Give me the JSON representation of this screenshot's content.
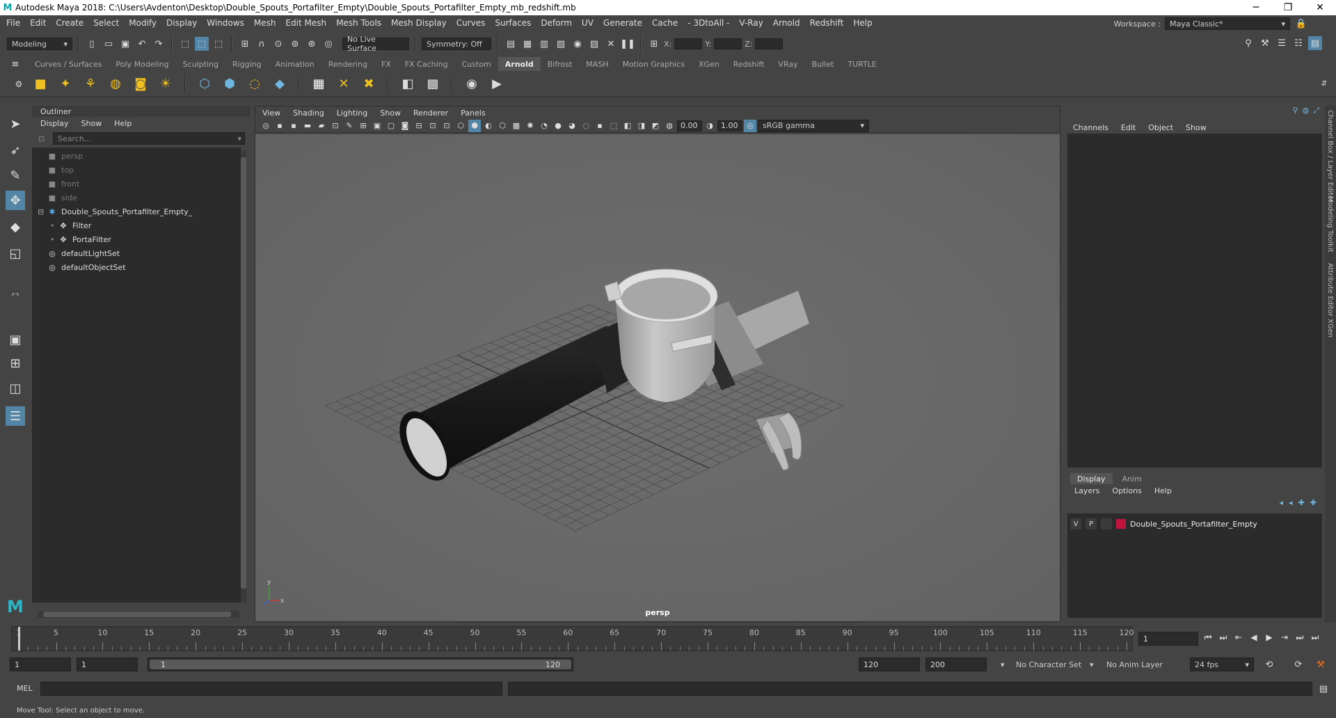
{
  "window": {
    "title": "Autodesk Maya 2018: C:\\Users\\Avdenton\\Desktop\\Double_Spouts_Portafilter_Empty\\Double_Spouts_Portafilter_Empty_mb_redshift.mb",
    "logo": "M"
  },
  "menubar": {
    "items": [
      "File",
      "Edit",
      "Create",
      "Select",
      "Modify",
      "Display",
      "Windows",
      "Mesh",
      "Edit Mesh",
      "Mesh Tools",
      "Mesh Display",
      "Curves",
      "Surfaces",
      "Deform",
      "UV",
      "Generate",
      "Cache",
      "- 3DtoAll -",
      "V-Ray",
      "Arnold",
      "Redshift",
      "Help"
    ],
    "workspace_label": "Workspace :",
    "workspace_value": "Maya Classic*"
  },
  "statusline": {
    "mode": "Modeling",
    "live_surface": "No Live Surface",
    "symmetry": "Symmetry: Off",
    "x_label": "X:",
    "y_label": "Y:",
    "z_label": "Z:"
  },
  "shelf": {
    "tabs": [
      "Curves / Surfaces",
      "Poly Modeling",
      "Sculpting",
      "Rigging",
      "Animation",
      "Rendering",
      "FX",
      "FX Caching",
      "Custom",
      "Arnold",
      "Bifrost",
      "MASH",
      "Motion Graphics",
      "XGen",
      "Redshift",
      "VRay",
      "Bullet",
      "TURTLE"
    ],
    "active_tab": "Arnold"
  },
  "outliner": {
    "title": "Outliner",
    "menu": [
      "Display",
      "Show",
      "Help"
    ],
    "search_placeholder": "Search...",
    "items": [
      {
        "label": "persp",
        "icon": "camera-icon",
        "depth": 0,
        "dim": true
      },
      {
        "label": "top",
        "icon": "camera-icon",
        "depth": 0,
        "dim": true
      },
      {
        "label": "front",
        "icon": "camera-icon",
        "depth": 0,
        "dim": true
      },
      {
        "label": "side",
        "icon": "camera-icon",
        "depth": 0,
        "dim": true
      },
      {
        "label": "Double_Spouts_Portafilter_Empty_",
        "icon": "group-icon",
        "depth": 0,
        "dim": false,
        "expanded": true
      },
      {
        "label": "Filter",
        "icon": "transform-icon",
        "depth": 1,
        "dim": false
      },
      {
        "label": "PortaFilter",
        "icon": "transform-icon",
        "depth": 1,
        "dim": false
      },
      {
        "label": "defaultLightSet",
        "icon": "set-icon",
        "depth": 0,
        "dim": false
      },
      {
        "label": "defaultObjectSet",
        "icon": "set-icon",
        "depth": 0,
        "dim": false
      }
    ]
  },
  "viewport": {
    "menu": [
      "View",
      "Shading",
      "Lighting",
      "Show",
      "Renderer",
      "Panels"
    ],
    "exposure": "0.00",
    "gamma": "1.00",
    "colorspace": "sRGB gamma",
    "camera": "persp",
    "axis_x": "x",
    "axis_y": "y"
  },
  "channelbox": {
    "menu": [
      "Channels",
      "Edit",
      "Object",
      "Show"
    ],
    "layer_tabs": [
      "Display",
      "Anim"
    ],
    "layer_menu": [
      "Layers",
      "Options",
      "Help"
    ],
    "layer": {
      "v": "V",
      "p": "P",
      "name": "Double_Spouts_Portafilter_Empty",
      "color": "#c0143c"
    }
  },
  "sidetabs": [
    "Channel Box / Layer Editor",
    "Modeling Toolkit",
    "Attribute Editor",
    "XGen"
  ],
  "timeline": {
    "labels": [
      "1",
      "5",
      "10",
      "15",
      "20",
      "25",
      "30",
      "35",
      "40",
      "45",
      "50",
      "55",
      "60",
      "65",
      "70",
      "75",
      "80",
      "85",
      "90",
      "95",
      "100",
      "105",
      "110",
      "115",
      "120"
    ],
    "current_frame": "1"
  },
  "range": {
    "start": "1",
    "playback_start": "1",
    "slider_start": "1",
    "slider_end": "120",
    "playback_end": "120",
    "end": "200",
    "character_set": "No Character Set",
    "anim_layer": "No Anim Layer",
    "fps": "24 fps"
  },
  "commandline": {
    "label": "MEL"
  },
  "helpline": {
    "text": "Move Tool: Select an object to move."
  }
}
